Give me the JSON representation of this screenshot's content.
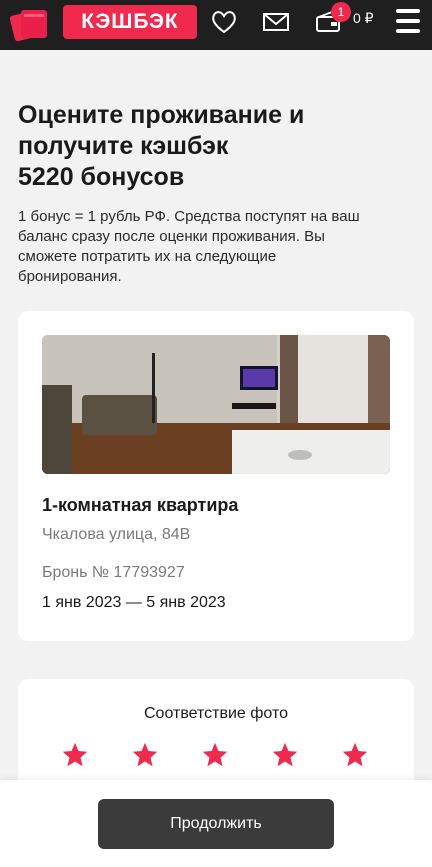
{
  "header": {
    "brand": "КЭШБЭК",
    "badge_count": "1",
    "balance": "0 ₽",
    "icons": [
      "logo-icon",
      "heart-icon",
      "mail-icon",
      "wallet-icon",
      "menu-icon"
    ]
  },
  "main": {
    "title_line1": "Оцените проживание и",
    "title_line2": "получите кэшбэк",
    "title_line3": "5220 бонусов",
    "description": "1 бонус = 1 рубль РФ. Средства поступят на ваш баланс сразу после оценки проживания. Вы сможете потратить их на следующие бронирования."
  },
  "booking": {
    "apartment": "1-комнатная квартира",
    "address": "Чкалова улица, 84В",
    "number": "Бронь № 17793927",
    "dates": "1 янв 2023 — 5 янв 2023"
  },
  "rating": {
    "label": "Соответствие фото",
    "stars": 5,
    "star_color": "#f0294f"
  },
  "footer": {
    "continue_label": "Продолжить"
  },
  "colors": {
    "accent": "#f0294f",
    "header_bg": "#1f1f1f",
    "button_bg": "#3b3b3b"
  }
}
